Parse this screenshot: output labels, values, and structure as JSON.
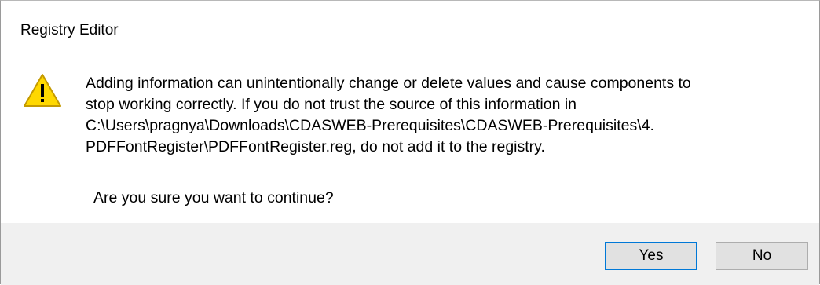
{
  "window": {
    "title": "Registry Editor"
  },
  "message": {
    "icon": "warning-icon",
    "text": "Adding information can unintentionally change or delete values and cause components to\nstop working correctly. If you do not trust the source of this information in\nC:\\Users\\pragnya\\Downloads\\CDASWEB-Prerequisites\\CDASWEB-Prerequisites\\4.\nPDFFontRegister\\PDFFontRegister.reg, do not add it to the registry.",
    "question": "Are you sure you want to continue?"
  },
  "buttons": {
    "yes_label": "Yes",
    "no_label": "No"
  },
  "colors": {
    "warning_fill": "#FFD800",
    "warning_stroke": "#C49A00",
    "default_button_border": "#0078D7",
    "footer_background": "#F0F0F0"
  }
}
